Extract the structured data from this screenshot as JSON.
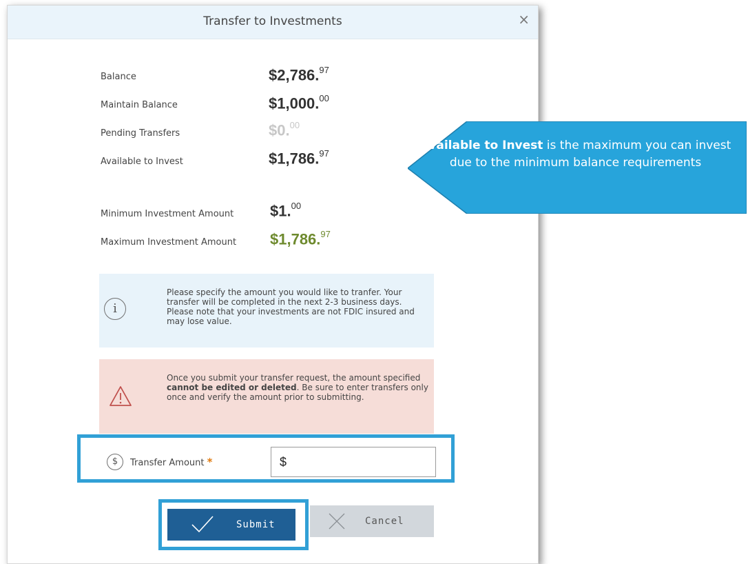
{
  "dialog": {
    "title": "Transfer to Investments",
    "close_label": "×"
  },
  "summary": [
    {
      "label": "Balance",
      "dollars": "$2,786.",
      "cents": "97"
    },
    {
      "label": "Maintain Balance",
      "dollars": "$1,000.",
      "cents": "00"
    },
    {
      "label": "Pending Transfers",
      "dollars": "$0.",
      "cents": "00"
    },
    {
      "label": "Available to Invest",
      "dollars": "$1,786.",
      "cents": "97"
    }
  ],
  "limits": [
    {
      "label": "Minimum Investment Amount",
      "dollars": "$1.",
      "cents": "00"
    },
    {
      "label": "Maximum Investment Amount",
      "dollars": "$1,786.",
      "cents": "97"
    }
  ],
  "info_message": {
    "icon": "info-icon",
    "glyph": "i",
    "text": "Please specify the amount you would like to tranfer. Your transfer will be completed in the next 2-3 business days. Please note that your investments are not FDIC insured and may lose value."
  },
  "warning_message": {
    "icon": "warning-icon",
    "text_before": "Once you submit your transfer request, the amount specified ",
    "text_bold": "cannot be edited or deleted",
    "text_after": ". Be sure to enter transfers only once and verify the amount prior to submitting."
  },
  "transfer_field": {
    "icon": "dollar-icon",
    "icon_glyph": "$",
    "label": "Transfer Amount",
    "required_mark": "*",
    "placeholder": "$"
  },
  "buttons": {
    "submit": "Submit",
    "cancel": "Cancel"
  },
  "callout": {
    "bold": "Available to Invest",
    "text": " is the maximum you can invest due to the minimum balance requirements"
  },
  "colors": {
    "header_bg": "#eaf4fb",
    "highlight_border": "#31a0d6",
    "callout_bg": "#27a4db",
    "submit_bg": "#1f5f95",
    "max_amount": "#6e8a2e",
    "pending_amount": "#c7c7c7",
    "info_bg": "#e8f3fa",
    "warning_bg": "#f6ddd8",
    "required": "#e07b10"
  }
}
